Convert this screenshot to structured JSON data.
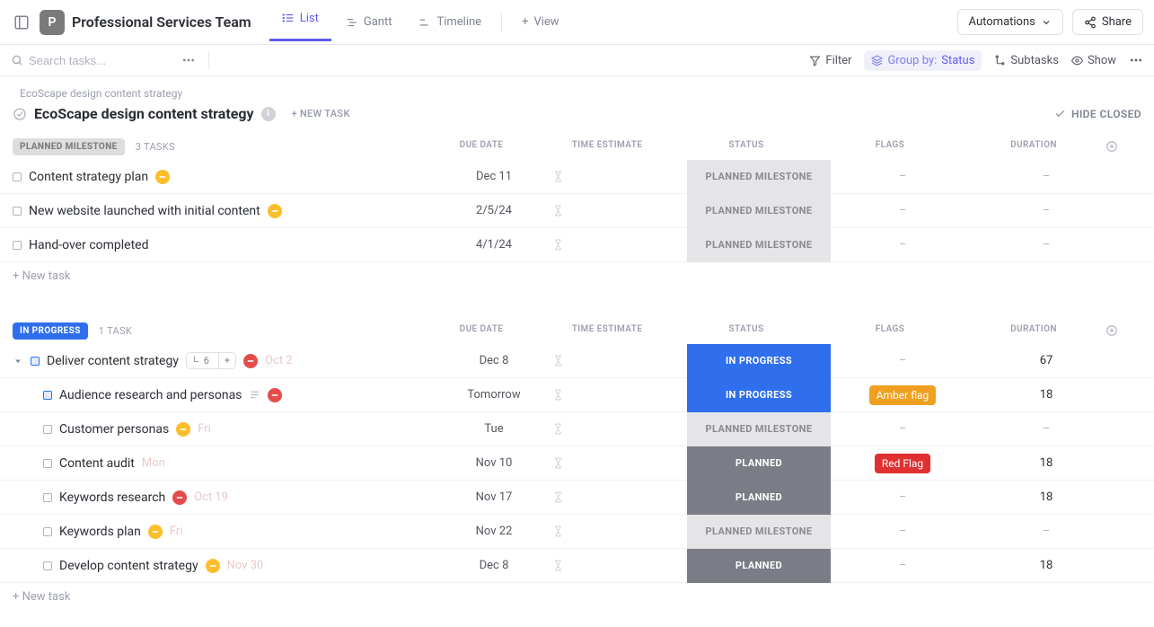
{
  "workspace": {
    "letter": "P",
    "title": "Professional Services Team"
  },
  "views": {
    "list": "List",
    "gantt": "Gantt",
    "timeline": "Timeline",
    "addView": "View"
  },
  "topbar": {
    "automations": "Automations",
    "share": "Share"
  },
  "toolbar": {
    "searchPlaceholder": "Search tasks...",
    "filter": "Filter",
    "groupByLabel": "Group by:",
    "groupByValue": "Status",
    "subtasks": "Subtasks",
    "show": "Show"
  },
  "breadcrumb": "EcoScape design content strategy",
  "pageTitle": "EcoScape design content strategy",
  "newTaskTop": "+ NEW TASK",
  "hideClosed": "HIDE CLOSED",
  "columns": {
    "due": "DUE DATE",
    "estimate": "TIME ESTIMATE",
    "status": "STATUS",
    "flags": "FLAGS",
    "duration": "DURATION"
  },
  "newTaskRow": "+ New task",
  "groups": [
    {
      "chip": "PLANNED MILESTONE",
      "chipClass": "chip-planned-milestone",
      "count": "3 TASKS",
      "rows": [
        {
          "name": "Content strategy plan",
          "pill": "yellow",
          "due": "Dec 11",
          "status": "PLANNED MILESTONE",
          "statusClass": "st-planned-milestone",
          "flags": "–",
          "duration": "–"
        },
        {
          "name": "New website launched with initial content",
          "pill": "yellow",
          "due": "2/5/24",
          "status": "PLANNED MILESTONE",
          "statusClass": "st-planned-milestone",
          "flags": "–",
          "duration": "–"
        },
        {
          "name": "Hand-over completed",
          "due": "4/1/24",
          "status": "PLANNED MILESTONE",
          "statusClass": "st-planned-milestone",
          "flags": "–",
          "duration": "–"
        }
      ]
    },
    {
      "chip": "IN PROGRESS",
      "chipClass": "chip-inprogress",
      "count": "1 TASK",
      "rows": [
        {
          "name": "Deliver content strategy",
          "expandable": true,
          "sqBlue": true,
          "subtaskCount": "6",
          "pillAfter": "red",
          "faded": "Oct 2",
          "due": "Dec 8",
          "status": "IN PROGRESS",
          "statusClass": "st-inprogress",
          "flags": "–",
          "duration": "67"
        },
        {
          "sub": true,
          "sqBlue": true,
          "name": "Audience research and personas",
          "descIcon": true,
          "pillAfterName": "red",
          "due": "Tomorrow",
          "status": "IN PROGRESS",
          "statusClass": "st-inprogress",
          "flagBadge": "Amber flag",
          "flagClass": "flag-amber",
          "duration": "18"
        },
        {
          "sub": true,
          "name": "Customer personas",
          "pillAfterName": "yellow",
          "faded": "Fri",
          "due": "Tue",
          "status": "PLANNED MILESTONE",
          "statusClass": "st-planned-milestone",
          "flags": "–",
          "duration": "–"
        },
        {
          "sub": true,
          "name": "Content audit",
          "faded": "Mon",
          "due": "Nov 10",
          "status": "PLANNED",
          "statusClass": "st-planned",
          "flagBadge": "Red Flag",
          "flagClass": "flag-red",
          "duration": "18"
        },
        {
          "sub": true,
          "name": "Keywords research",
          "pillAfterName": "red",
          "faded": "Oct 19",
          "due": "Nov 17",
          "status": "PLANNED",
          "statusClass": "st-planned",
          "flags": "–",
          "duration": "18"
        },
        {
          "sub": true,
          "name": "Keywords plan",
          "pillAfterName": "yellow",
          "faded": "Fri",
          "due": "Nov 22",
          "status": "PLANNED MILESTONE",
          "statusClass": "st-planned-milestone",
          "flags": "–",
          "duration": "–"
        },
        {
          "sub": true,
          "name": "Develop content strategy",
          "pillAfterName": "yellow",
          "faded": "Nov 30",
          "due": "Dec 8",
          "status": "PLANNED",
          "statusClass": "st-planned",
          "flags": "–",
          "duration": "18"
        }
      ]
    }
  ]
}
